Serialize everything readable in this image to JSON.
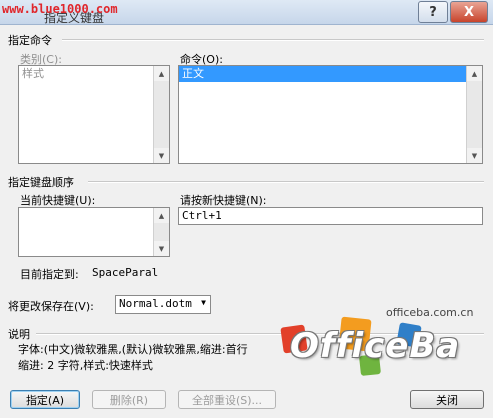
{
  "window": {
    "watermark": "www.blue1000.com",
    "title": "指定义键盘",
    "help_button": "?",
    "close_button": "X"
  },
  "section_command": {
    "title": "指定命令"
  },
  "categories": {
    "label": "类别(C):",
    "items": [
      "样式"
    ]
  },
  "commands": {
    "label": "命令(O):",
    "items": [
      "正文"
    ]
  },
  "section_sequence": {
    "title": "指定键盘顺序"
  },
  "current_keys": {
    "label": "当前快捷键(U):"
  },
  "new_key": {
    "label": "请按新快捷键(N):",
    "value": "Ctrl+1"
  },
  "assigned_to": {
    "label": "目前指定到:",
    "value": "SpaceParal"
  },
  "save_in": {
    "label": "将更改保存在(V):",
    "value": "Normal.dotm"
  },
  "description": {
    "title": "说明",
    "line1": "字体:(中文)微软雅黑,(默认)微软雅黑,缩进:首行",
    "line2": "缩进: 2 字符,样式:快速样式"
  },
  "buttons": {
    "assign": "指定(A)",
    "remove": "删除(R)",
    "reset_all": "全部重设(S)...",
    "close": "关闭"
  },
  "logo": {
    "site": "officeba.com.cn",
    "text": "OfficeBa",
    "colors": [
      "#e2402a",
      "#f39c1f",
      "#6fb43f",
      "#2f7fc8"
    ]
  }
}
